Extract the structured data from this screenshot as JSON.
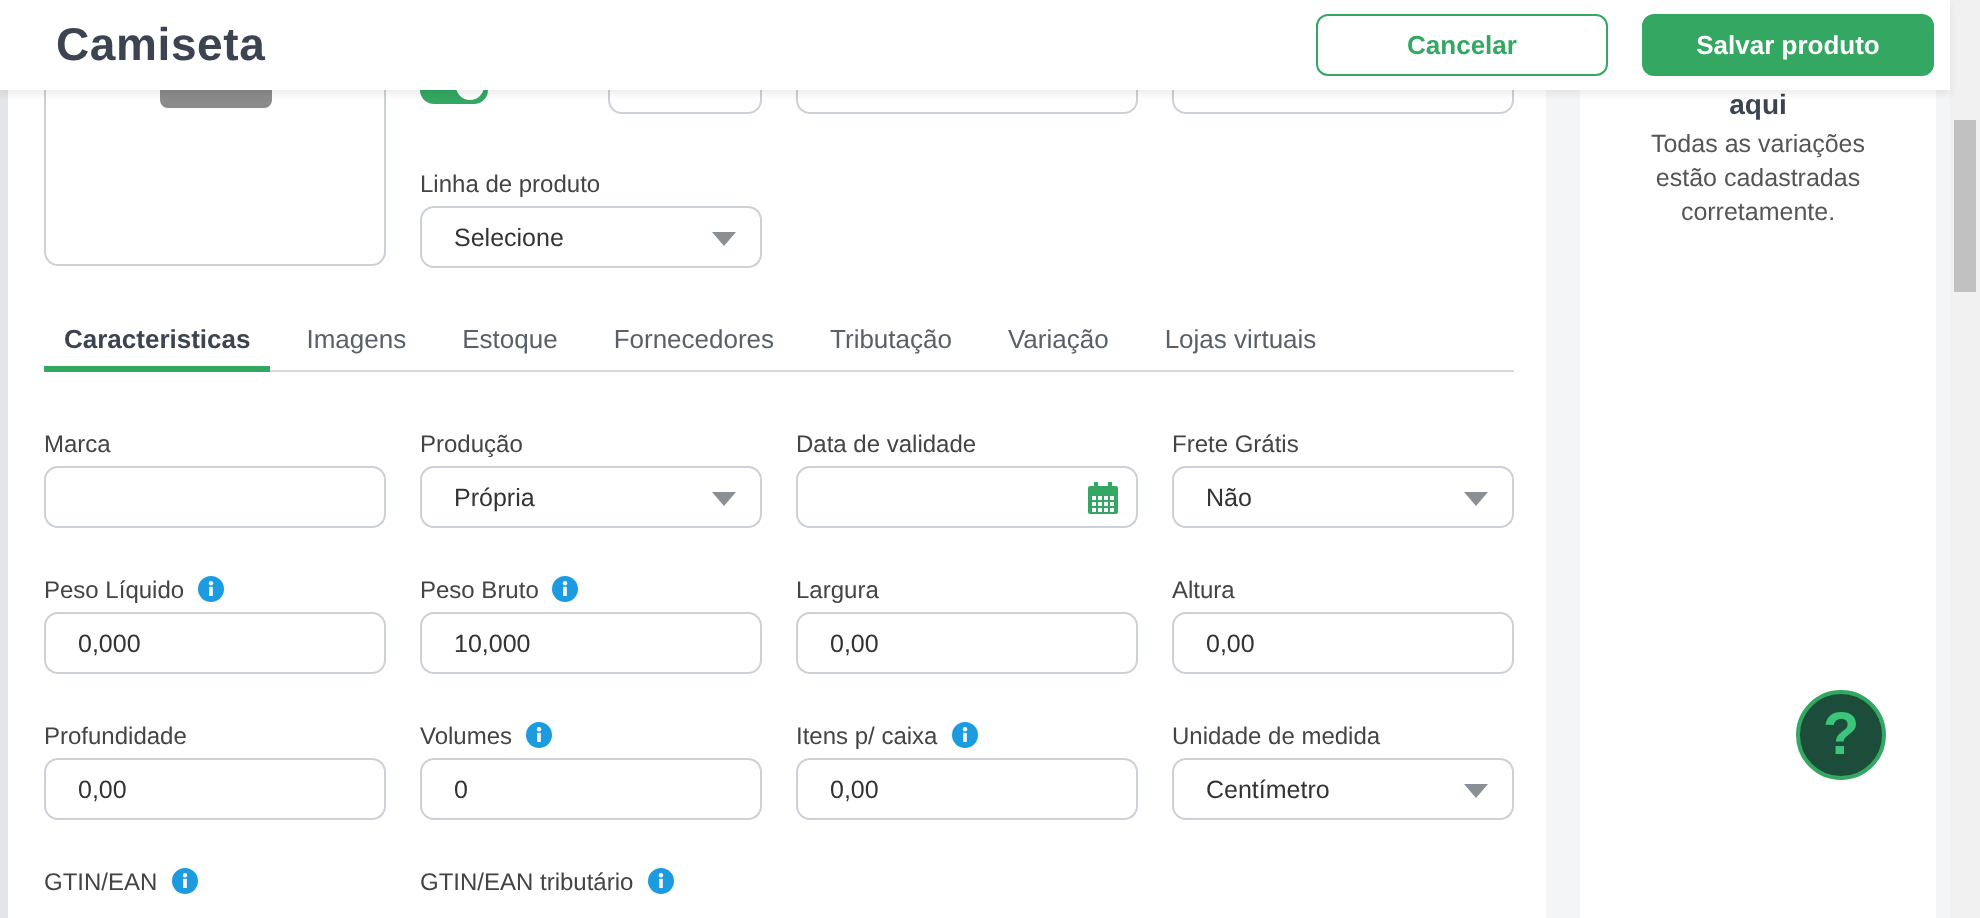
{
  "header": {
    "title": "Camiseta",
    "buttons": [
      {
        "label": "Cancelar",
        "kind": "secondary"
      },
      {
        "label": "Salvar produto",
        "kind": "primary"
      }
    ]
  },
  "top_section": {
    "status_toggle": {
      "on": true
    },
    "product_line": {
      "label": "Linha de produto",
      "value": "Selecione"
    }
  },
  "tabs": [
    {
      "label": "Caracteristicas",
      "selected": true
    },
    {
      "label": "Imagens",
      "selected": false
    },
    {
      "label": "Estoque",
      "selected": false
    },
    {
      "label": "Fornecedores",
      "selected": false
    },
    {
      "label": "Tributação",
      "selected": false
    },
    {
      "label": "Variação",
      "selected": false
    },
    {
      "label": "Lojas virtuais",
      "selected": false
    }
  ],
  "fields": [
    {
      "label": "Marca",
      "kind": "text",
      "info": false
    },
    {
      "label": "Produção",
      "kind": "select",
      "value": "Própria",
      "info": false
    },
    {
      "label": "Data de validade",
      "kind": "date",
      "info": false
    },
    {
      "label": "Frete Grátis",
      "kind": "select",
      "value": "Não",
      "info": false
    },
    {
      "label": "Peso Líquido",
      "kind": "text",
      "value": "0,000",
      "info": true
    },
    {
      "label": "Peso Bruto",
      "kind": "text",
      "value": "10,000",
      "info": true
    },
    {
      "label": "Largura",
      "kind": "text",
      "value": "0,00",
      "info": false
    },
    {
      "label": "Altura",
      "kind": "text",
      "value": "0,00",
      "info": false
    },
    {
      "label": "Profundidade",
      "kind": "text",
      "value": "0,00",
      "info": false
    },
    {
      "label": "Volumes",
      "kind": "text",
      "value": "0",
      "info": true
    },
    {
      "label": "Itens p/ caixa",
      "kind": "text",
      "value": "0,00",
      "info": true
    },
    {
      "label": "Unidade de medida",
      "kind": "select",
      "value": "Centímetro",
      "info": false
    },
    {
      "label": "GTIN/EAN",
      "kind": "label",
      "info": true
    },
    {
      "label": "GTIN/EAN tributário",
      "kind": "label",
      "info": true
    }
  ],
  "variations_panel": {
    "heading": "aqui",
    "message": "Todas as variações estão cadastradas corretamente."
  },
  "help_button": {
    "label": "?"
  }
}
